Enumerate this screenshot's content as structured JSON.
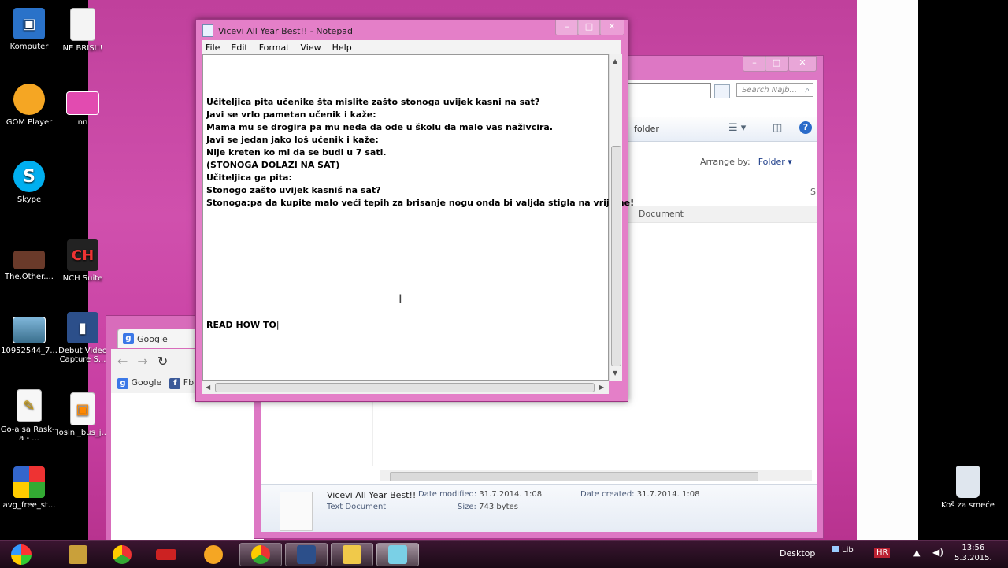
{
  "desktop_icons": [
    {
      "label": "Komputer",
      "icon": "computer-icon"
    },
    {
      "label": "NE BRISI!!",
      "icon": "file-icon"
    },
    {
      "label": "GOM Player",
      "icon": "gom-player-icon"
    },
    {
      "label": "nn",
      "icon": "image-icon"
    },
    {
      "label": "Skype",
      "icon": "skype-icon"
    },
    {
      "label": "The.Other....",
      "icon": "video-icon"
    },
    {
      "label": "NCH Suite",
      "icon": "nch-icon"
    },
    {
      "label": "10952544_7...",
      "icon": "picture-icon"
    },
    {
      "label": "Debut Video Capture S...",
      "icon": "debut-icon"
    },
    {
      "label": "Go-a sa Rask--a - ...",
      "icon": "doc-icon"
    },
    {
      "label": "losinj_bus_j...",
      "icon": "pdf-icon"
    },
    {
      "label": "avg_free_st...",
      "icon": "avg-icon"
    },
    {
      "label": "Koš za smeće",
      "icon": "recycle-bin-icon"
    }
  ],
  "notepad": {
    "title": "Vicevi All Year Best!! - Notepad",
    "menu": [
      "File",
      "Edit",
      "Format",
      "View",
      "Help"
    ],
    "lines": "Učiteljica pita učenike šta mislite zašto stonoga uvijek kasni na sat?\nJavi se vrlo pametan učenik i kaže:\nMama mu se drogira pa mu neda da ode u školu da malo vas naživcira.\nJavi se jedan jako loš učenik i kaže:\nNije kreten ko mi da se budi u 7 sati.\n(STONOGA DOLAZI NA SAT)\nUčiteljica ga pita:\nStonogo zašto uvijek kasniš na sat?\nStonoga:pa da kupite malo veći tepih za brisanje nogu onda bi valjda stigla na vrijeme!",
    "bottom_text": "READ HOW TO"
  },
  "explorer": {
    "search_placeholder": "Search Najb...",
    "toolbar_folder": "folder",
    "arrange_label": "Arrange by:",
    "arrange_value": "Folder",
    "row_type": "Document",
    "col_s": "Si",
    "details": {
      "name": "Vicevi All Year Best!!",
      "modified_label": "Date modified:",
      "modified_value": "31.7.2014. 1:08",
      "created_label": "Date created:",
      "created_value": "31.7.2014. 1:08",
      "type": "Text Document",
      "size_label": "Size:",
      "size_value": "743 bytes"
    }
  },
  "chrome": {
    "tab_title": "Google",
    "bookmarks": [
      "Google",
      "Fb"
    ]
  },
  "taskbar": {
    "desktop_label": "Desktop",
    "lib_label": "Lib",
    "lang": "HR",
    "time": "13:56",
    "date": "5.3.2015."
  },
  "colors": {
    "desktop": "#c0409c",
    "window_frame": "#e47fc8",
    "taskbar": "#2a0f24"
  }
}
